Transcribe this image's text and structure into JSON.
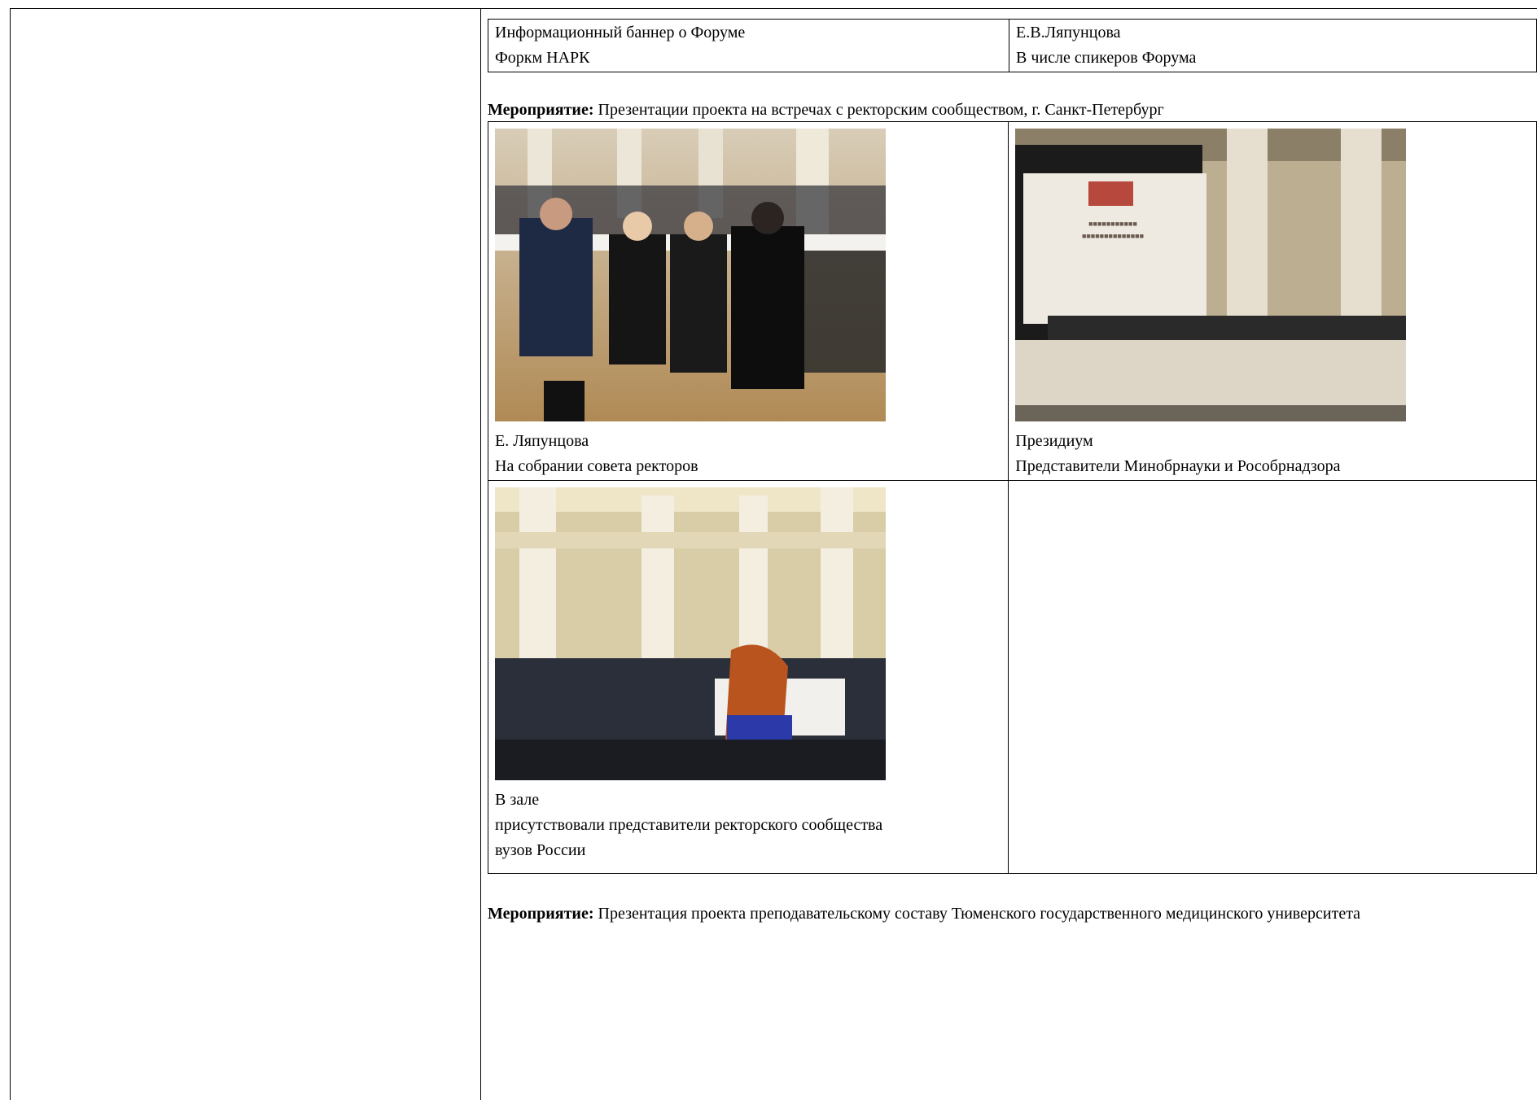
{
  "top_row": {
    "left": [
      "Информационный баннер о Форуме",
      "Форкм НАРК"
    ],
    "right": [
      "Е.В.Ляпунцова",
      "В числе спикеров Форума"
    ]
  },
  "event1": {
    "label": "Мероприятие:",
    "text": "Презентации проекта на встречах с ректорским сообществом, г. Санкт-Петербург"
  },
  "photos": [
    {
      "icon": "rectors-meeting-photo",
      "caption": [
        "Е. Ляпунцова",
        "На собрании совета ректоров"
      ]
    },
    {
      "icon": "presidium-photo",
      "caption": [
        "Президиум",
        "Представители Минобрнауки и Рособрнадзора"
      ]
    },
    {
      "icon": "hall-audience-photo",
      "caption": [
        "В зале",
        "присутствовали представители ректорского сообщества",
        "вузов России"
      ]
    }
  ],
  "event2": {
    "label": "Мероприятие:",
    "text": "Презентация проекта преподавательскому составу Тюменского государственного медицинского университета"
  }
}
